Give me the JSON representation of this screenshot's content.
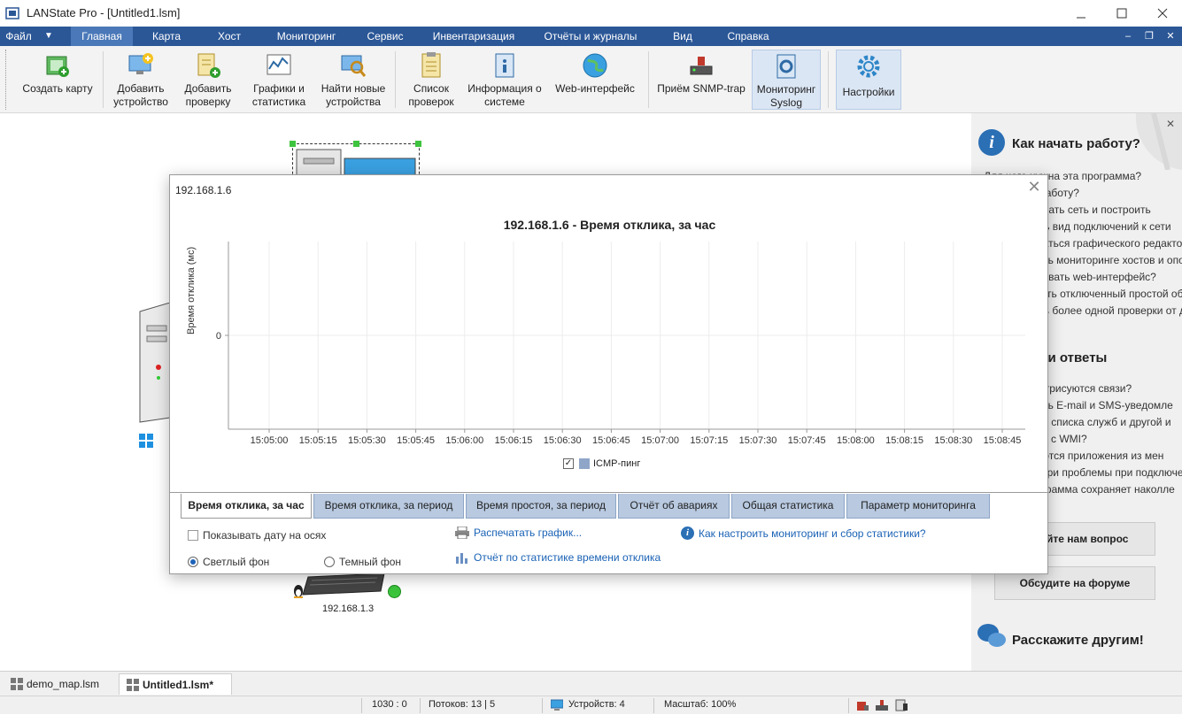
{
  "window": {
    "title": "LANState Pro - [Untitled1.lsm]"
  },
  "menu": {
    "items": [
      "Файл",
      "Главная",
      "Карта",
      "Хост",
      "Мониторинг",
      "Сервис",
      "Инвентаризация",
      "Отчёты и журналы",
      "Вид",
      "Справка"
    ],
    "active": "Главная"
  },
  "ribbon": {
    "buttons": [
      {
        "label1": "Создать карту",
        "label2": "",
        "icon": "create-map-icon"
      },
      {
        "label1": "Добавить",
        "label2": "устройство",
        "icon": "add-device-icon"
      },
      {
        "label1": "Добавить",
        "label2": "проверку",
        "icon": "add-check-icon"
      },
      {
        "label1": "Графики и",
        "label2": "статистика",
        "icon": "charts-icon"
      },
      {
        "label1": "Найти новые",
        "label2": "устройства",
        "icon": "find-devices-icon"
      },
      {
        "label1": "Список",
        "label2": "проверок",
        "icon": "check-list-icon"
      },
      {
        "label1": "Информация о",
        "label2": "системе",
        "icon": "system-info-icon"
      },
      {
        "label1": "Web-интерфейс",
        "label2": "",
        "icon": "globe-icon"
      },
      {
        "label1": "Приём SNMP-trap",
        "label2": "",
        "icon": "snmp-trap-icon"
      },
      {
        "label1": "Мониторинг",
        "label2": "Syslog",
        "icon": "syslog-icon"
      },
      {
        "label1": "Настройки",
        "label2": "",
        "icon": "gear-icon"
      }
    ]
  },
  "canvas": {
    "host_label": "192.168.1.3"
  },
  "right_panel": {
    "heading1": "Как начать работу?",
    "links1": [
      "Для чего нужна эта программа?",
      "Как начать работу?",
      "Как сканировать сеть и построить",
      "Как изменить вид подключений к сети",
      "Как пользоваться графического редактора",
      "Как настроить мониторинге хостов и оповещ",
      "Как использовать web-интерфейс?",
      "Как выключать отключенный простой оборудо",
      "Как добавить более одной проверки от дру"
    ],
    "heading2": "Вопросы и ответы",
    "links2": [
      "Почему не отрисуются связи?",
      "Как настроить E-mail и SMS-уведомле",
      "Как получить списка служб и другой и",
      "Как работает с WMI?",
      "Как запускаются приложения из мен",
      "Что делать при проблемы при подключе",
      "Почему программа сохраняет наколле"
    ],
    "btn_ask": "Задайте нам вопрос",
    "btn_forum": "Обсудите на форуме",
    "heading3": "Расскажите другим!"
  },
  "dialog": {
    "title": "192.168.1.6",
    "chart_title": "192.168.1.6 - Время отклика, за час",
    "tabs": [
      "Время отклика, за час",
      "Время отклика, за период",
      "Время простоя, за период",
      "Отчёт об авариях",
      "Общая статистика",
      "Параметр мониторинга"
    ],
    "active_tab": 0,
    "opt_show_date": "Показывать дату на осях",
    "opt_light": "Светлый фон",
    "opt_dark": "Темный фон",
    "link_print": "Распечатать график...",
    "link_report": "Отчёт по статистике времени отклика",
    "link_howto": "Как настроить мониторинг и сбор статистики?"
  },
  "chart_data": {
    "type": "line",
    "title": "192.168.1.6 - Время отклика, за час",
    "xlabel": "",
    "ylabel": "Время отклика (мс)",
    "x_ticks": [
      "15:05:00",
      "15:05:15",
      "15:05:30",
      "15:05:45",
      "15:06:00",
      "15:06:15",
      "15:06:30",
      "15:06:45",
      "15:07:00",
      "15:07:15",
      "15:07:30",
      "15:07:45",
      "15:08:00",
      "15:08:15",
      "15:08:30",
      "15:08:45"
    ],
    "y_ticks": [
      0
    ],
    "ylim": [
      -1,
      1
    ],
    "grid": true,
    "series": [
      {
        "name": "ICMP-пинг",
        "values": []
      }
    ],
    "legend": "bottom-center"
  },
  "doc_tabs": [
    "demo_map.lsm",
    "Untitled1.lsm*"
  ],
  "status": {
    "coords": "1030 : 0",
    "threads": "Потоков: 13 | 5",
    "devices": "Устройств: 4",
    "zoom": "Масштаб: 100%"
  }
}
